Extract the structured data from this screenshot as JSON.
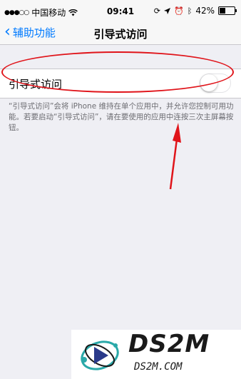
{
  "status_bar": {
    "carrier": "中国移动",
    "time": "09:41",
    "battery_text": "42%",
    "battery_level": 0.42,
    "icons": [
      "signal-dots-icon",
      "wifi-icon",
      "rotation-lock-icon",
      "location-icon",
      "alarm-icon",
      "bluetooth-icon",
      "battery-icon"
    ]
  },
  "nav": {
    "back_label": "辅助功能",
    "title": "引导式访问"
  },
  "settings": {
    "toggle_label": "引导式访问",
    "toggle_on": false,
    "footer": "“引导式访问”会将 iPhone 维持在单个应用中，并允许您控制可用功能。若要启动“引导式访问”，请在要使用的应用中连按三次主屏幕按钮。"
  },
  "watermark": {
    "big_text": "DS2M",
    "small_text": "DS2M.COM"
  },
  "colors": {
    "accent": "#007aff",
    "annotation": "#e0141a",
    "background": "#efeff4"
  }
}
